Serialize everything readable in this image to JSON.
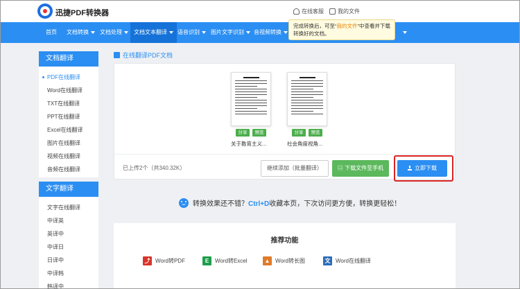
{
  "header": {
    "brand": "迅捷PDF转换器",
    "service_label": "在线客服",
    "files_label": "我的文件"
  },
  "nav": {
    "items": [
      "首页",
      "文档转换",
      "文档处理",
      "文档文本翻译",
      "语音识别",
      "图片文字识别",
      "音视频转换"
    ],
    "active_index": 3
  },
  "tooltip": {
    "line1_a": "完成转换后，可至“",
    "line1_q": "我的文件",
    "line1_b": "”中查看并下载",
    "line2": "转换好的文档。"
  },
  "sidebar": {
    "doc_heading": "文档翻译",
    "doc_items": [
      "PDF在线翻译",
      "Word在线翻译",
      "TXT在线翻译",
      "PPT在线翻译",
      "Excel在线翻译",
      "图片在线翻译",
      "视频在线翻译",
      "音频在线翻译"
    ],
    "text_heading": "文字翻译",
    "text_items": [
      "文字在线翻译",
      "中译英",
      "英译中",
      "中译日",
      "日译中",
      "中译韩",
      "韩译中"
    ]
  },
  "main": {
    "title": "在线翻译PDF文档",
    "files": [
      {
        "name": "关于教育主义...",
        "share": "分享",
        "preview": "预览"
      },
      {
        "name": "社会角度视角...",
        "share": "分享",
        "preview": "预览"
      }
    ],
    "uploaded": "已上传2个（共340.32K）",
    "continue_add": "继续添加（批量翻译）",
    "download_phone": "下载文件至手机",
    "download_now": "立即下载"
  },
  "promo": {
    "text_a": "转换效果还不错？",
    "hotkey": "Ctrl+D",
    "text_b": "收藏本页，下次访问更方便，转换更轻松！"
  },
  "recommend": {
    "title": "推荐功能",
    "items": [
      {
        "label": "Word转PDF",
        "icon": "pdf-icon",
        "color": "#d9342b"
      },
      {
        "label": "Word转Excel",
        "icon": "excel-icon",
        "color": "#1e9e4a"
      },
      {
        "label": "Word转长图",
        "icon": "image-icon",
        "color": "#e07b2a"
      },
      {
        "label": "Word在线翻译",
        "icon": "translate-icon",
        "color": "#2b6cb8"
      }
    ]
  },
  "colors": {
    "primary": "#2b8ef2",
    "green": "#5cb85c",
    "highlight": "#d82323"
  }
}
